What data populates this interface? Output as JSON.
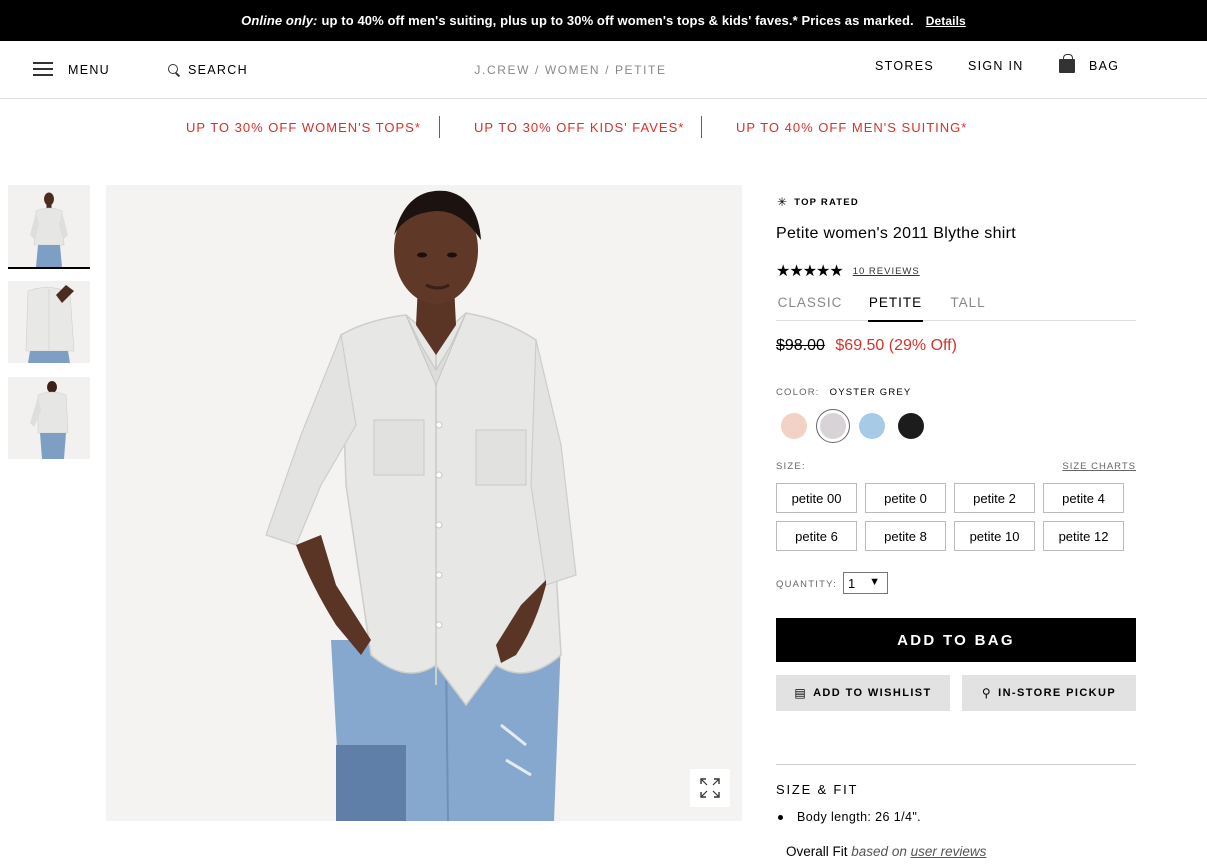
{
  "promo": {
    "prefix": "Online only:",
    "message": "up to 40% off men's suiting, plus up to 30% off women's tops & kids' faves.* Prices as marked.",
    "details_label": "Details"
  },
  "header": {
    "menu_label": "MENU",
    "search_label": "SEARCH",
    "breadcrumb": "J.CREW / WOMEN / PETITE",
    "stores_label": "STORES",
    "signin_label": "SIGN IN",
    "bag_label": "BAG"
  },
  "subpromos": [
    "UP TO 30% OFF WOMEN'S TOPS*",
    "UP TO 30% OFF KIDS' FAVES*",
    "UP TO 40% OFF MEN'S SUITING*"
  ],
  "icons": {
    "menu": "hamburger-icon",
    "search": "search-icon",
    "bag": "bag-icon",
    "top_rated": "asterisk-icon",
    "zoom": "expand-icon",
    "wishlist": "list-icon",
    "pickup": "location-pin-icon"
  },
  "product": {
    "badge": "TOP RATED",
    "badge_glyph": "✳",
    "title": "Petite women's 2011 Blythe shirt",
    "rating": 5,
    "stars_glyph": "★★★★★",
    "reviews_label": "10 REVIEWS",
    "fit_tabs": [
      "CLASSIC",
      "PETITE",
      "TALL"
    ],
    "fit_selected": "PETITE",
    "price_original": "$98.00",
    "price_sale": "$69.50 (29% Off)",
    "color_label": "COLOR:",
    "color_selected": "OYSTER GREY",
    "colors": [
      {
        "name": "blush",
        "hex": "#f1d2c4"
      },
      {
        "name": "oyster grey",
        "hex": "#d8d3d6"
      },
      {
        "name": "light blue",
        "hex": "#a7cbe6"
      },
      {
        "name": "black",
        "hex": "#1c1c1c"
      }
    ],
    "size_label": "SIZE:",
    "size_charts_label": "SIZE CHARTS",
    "sizes": [
      "petite 00",
      "petite 0",
      "petite 2",
      "petite 4",
      "petite 6",
      "petite 8",
      "petite 10",
      "petite 12"
    ],
    "quantity_label": "QUANTITY:",
    "quantity_value": "1",
    "quantity_arrow": "▼",
    "add_to_bag_label": "ADD TO BAG",
    "wishlist_label": "ADD TO WISHLIST",
    "pickup_label": "IN-STORE PICKUP",
    "wishlist_glyph": "▤",
    "pickup_glyph": "⚲",
    "size_fit_title": "SIZE & FIT",
    "body_length": "Body length: 26 1/4\".",
    "overall_fit_label": "Overall Fit",
    "overall_fit_mid": "based on",
    "overall_fit_link": "user reviews"
  },
  "colors": {
    "accent_red": "#d4332a",
    "black": "#000000",
    "secondary_button": "#e2e2e2"
  }
}
